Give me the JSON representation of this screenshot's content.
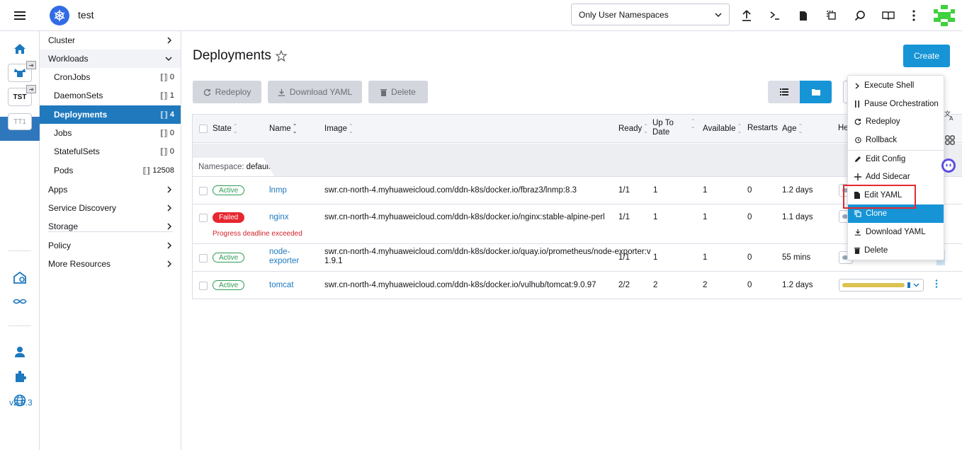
{
  "header": {
    "cluster_name": "test",
    "namespace_filter": "Only User Namespaces",
    "icons": [
      "upload-icon",
      "terminal-icon",
      "file-icon",
      "copy-icon",
      "search-icon",
      "book-icon",
      "more-vertical-icon"
    ]
  },
  "rail": {
    "cluster_badges": [
      "TST",
      "TT1"
    ],
    "version": "v2.9.3"
  },
  "sidenav": {
    "groups": {
      "cluster": "Cluster",
      "workloads": "Workloads",
      "apps": "Apps",
      "service_discovery": "Service Discovery",
      "storage": "Storage",
      "policy": "Policy",
      "more_resources": "More Resources"
    },
    "workloads": [
      {
        "label": "CronJobs",
        "count": "0"
      },
      {
        "label": "DaemonSets",
        "count": "1"
      },
      {
        "label": "Deployments",
        "count": "4"
      },
      {
        "label": "Jobs",
        "count": "0"
      },
      {
        "label": "StatefulSets",
        "count": "0"
      },
      {
        "label": "Pods",
        "count": "12508"
      }
    ]
  },
  "main": {
    "title": "Deployments",
    "create_label": "Create",
    "bulk": {
      "redeploy": "Redeploy",
      "download": "Download YAML",
      "delete": "Delete"
    }
  },
  "table": {
    "headers": {
      "state": "State",
      "name": "Name",
      "image": "Image",
      "ready": "Ready",
      "uptodate_1": "Up To",
      "uptodate_2": "Date",
      "available": "Available",
      "restarts": "Restarts",
      "age": "Age",
      "health": "He"
    },
    "namespace_label": "Namespace:",
    "namespace": "default",
    "rows": [
      {
        "state": "Active",
        "name": "lnmp",
        "image": "swr.cn-north-4.myhuaweicloud.com/ddn-k8s/docker.io/fbraz3/lnmp:8.3",
        "ready": "1/1",
        "uptodate": "1",
        "available": "1",
        "restarts": "0",
        "age": "1.2 days"
      },
      {
        "state": "Failed",
        "name": "nginx",
        "image": "swr.cn-north-4.myhuaweicloud.com/ddn-k8s/docker.io/nginx:stable-alpine-perl",
        "ready": "1/1",
        "uptodate": "1",
        "available": "1",
        "restarts": "0",
        "age": "1.1 days",
        "message": "Progress deadline exceeded"
      },
      {
        "state": "Active",
        "name_1": "node-",
        "name_2": "exporter",
        "image_1": "swr.cn-north-4.myhuaweicloud.com/ddn-k8s/docker.io/quay.io/prometheus/node-exporter:v",
        "image_2": "1.9.1",
        "ready": "1/1",
        "uptodate": "1",
        "available": "1",
        "restarts": "0",
        "age": "55 mins"
      },
      {
        "state": "Active",
        "name": "tomcat",
        "image": "swr.cn-north-4.myhuaweicloud.com/ddn-k8s/docker.io/vulhub/tomcat:9.0.97",
        "ready": "2/2",
        "uptodate": "2",
        "available": "2",
        "restarts": "0",
        "age": "1.2 days"
      }
    ]
  },
  "context_menu": {
    "items": [
      "Execute Shell",
      "Pause Orchestration",
      "Redeploy",
      "Rollback",
      "Edit Config",
      "Add Sidecar",
      "Edit YAML",
      "Clone",
      "Download YAML",
      "Delete"
    ],
    "highlighted": "Clone"
  },
  "colors": {
    "accent": "#1694d6",
    "nav_active": "#2079bd",
    "active_state": "#2d9c54",
    "failed_state": "#e7262f",
    "highlight_box": "#e5292f"
  }
}
